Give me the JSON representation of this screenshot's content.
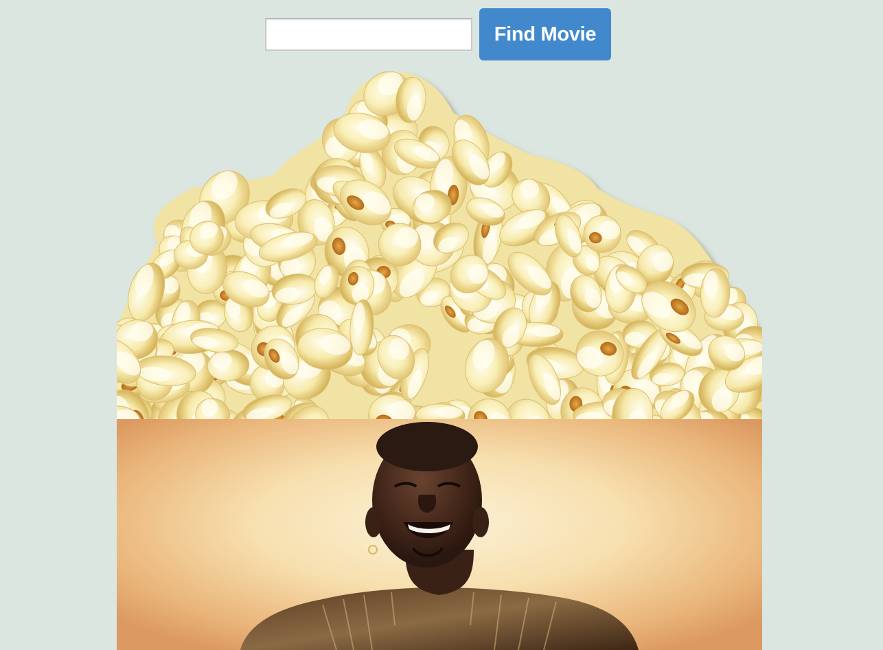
{
  "search": {
    "value": "",
    "placeholder": "",
    "button_label": "Find Movie"
  },
  "colors": {
    "background": "#dce6e0",
    "button": "#4189cc",
    "button_text": "#ffffff"
  },
  "images": {
    "popcorn": "popcorn-image",
    "poster": "movie-poster-photo"
  }
}
